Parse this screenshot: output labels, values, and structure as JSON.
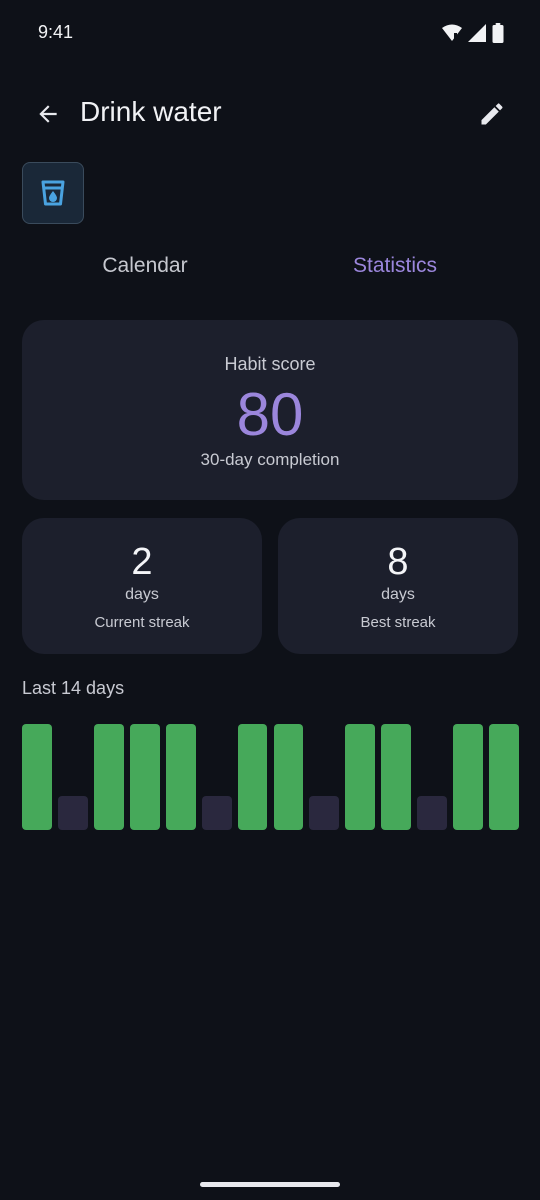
{
  "status_bar": {
    "time": "9:41",
    "icons": [
      "wifi-icon",
      "signal-icon",
      "battery-icon"
    ]
  },
  "header": {
    "title": "Drink water",
    "back_icon": "back-arrow-icon",
    "edit_icon": "pencil-icon"
  },
  "habit_icon": "water-glass-icon",
  "tabs": [
    {
      "label": "Calendar",
      "active": false
    },
    {
      "label": "Statistics",
      "active": true
    }
  ],
  "score_card": {
    "label": "Habit score",
    "value": "80",
    "subtitle": "30-day completion"
  },
  "streaks": {
    "current": {
      "value": "2",
      "unit": "days",
      "label": "Current streak"
    },
    "best": {
      "value": "8",
      "unit": "days",
      "label": "Best streak"
    }
  },
  "history": {
    "label": "Last 14 days",
    "days": [
      true,
      false,
      true,
      true,
      true,
      false,
      true,
      true,
      false,
      true,
      true,
      false,
      true,
      true
    ]
  },
  "colors": {
    "background": "#0e1118",
    "card": "#1c1f2c",
    "accent": "#9b86dc",
    "done": "#46a95a",
    "missed": "#2a283e",
    "icon_blue": "#4aa3e0"
  }
}
